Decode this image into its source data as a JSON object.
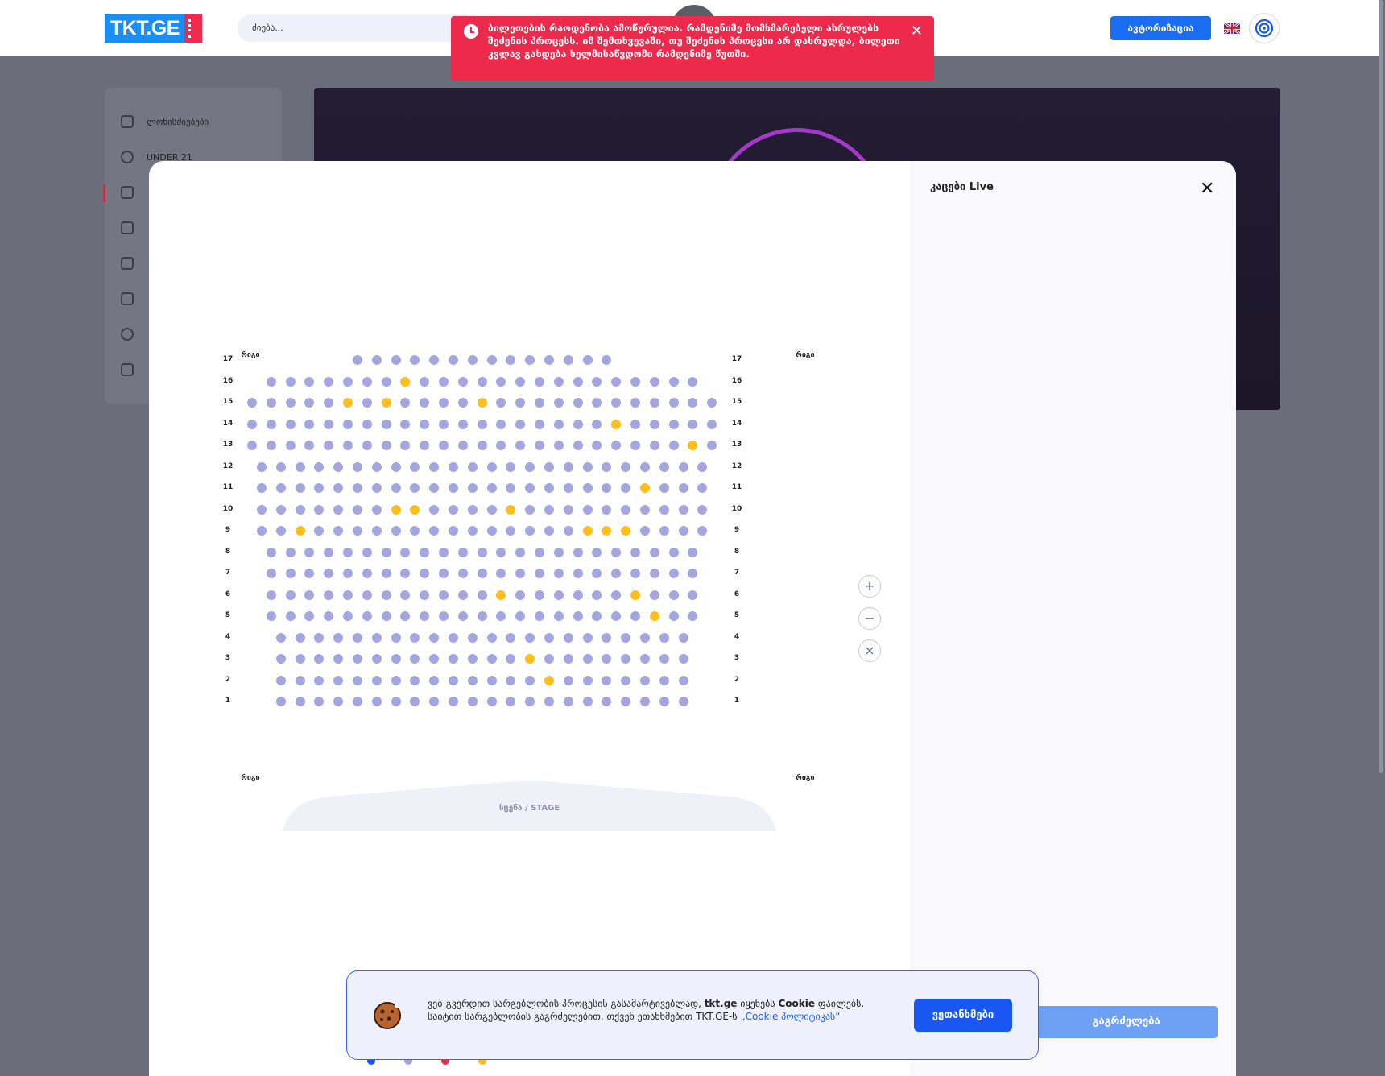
{
  "header": {
    "logo_text": "TKT.GE",
    "search_placeholder": "ძიება...",
    "auth_label": "ავტორიზაცია",
    "language_flag": "uk-flag-icon",
    "profile_icon": "settings-icon"
  },
  "sidebar": {
    "items": [
      {
        "label": "ლონისძიებები",
        "icon": "ticket-icon"
      },
      {
        "label": "UNDER 21",
        "icon": "globe-icon"
      },
      {
        "label": "",
        "icon": "music-icon"
      },
      {
        "label": "",
        "icon": "bus-icon"
      },
      {
        "label": "",
        "icon": "mask-icon"
      },
      {
        "label": "",
        "icon": "flag-icon"
      },
      {
        "label": "",
        "icon": "ball-icon"
      },
      {
        "label": "",
        "icon": "party-icon"
      }
    ]
  },
  "toast": {
    "message": "ბილეთების რაოდენობა ამოწურულია. რამდენიმე მომხმარებელი ასრულებს შეძენის პროცესს. იმ შემთხვევაში, თუ შეძენის პროცესი არ დასრულდა, ბილეთი კვლავ გახდება ხელმისაწვდომი რამდენიმე წუთში.",
    "close_label": "✕",
    "color": "#ee2a4c"
  },
  "modal": {
    "event_title": "კაცები Live",
    "close_label": "✕",
    "row_heading": "რიგი",
    "stage_label": "სცენა / STAGE",
    "continue_label": "გაგრძელება",
    "zoom": {
      "in": "+",
      "out": "−",
      "reset": "×"
    },
    "seat_colors": {
      "available": "#a5a6e0",
      "selected": "#fcbf1e"
    },
    "rows": [
      {
        "row": "17",
        "offset": 5.5,
        "count": 14,
        "selected": []
      },
      {
        "row": "16",
        "offset": 1,
        "count": 23,
        "selected": [
          8
        ]
      },
      {
        "row": "15",
        "offset": 0,
        "count": 25,
        "selected": [
          6,
          8,
          13
        ]
      },
      {
        "row": "14",
        "offset": 0,
        "count": 25,
        "selected": [
          20
        ]
      },
      {
        "row": "13",
        "offset": 0,
        "count": 25,
        "selected": [
          24
        ]
      },
      {
        "row": "12",
        "offset": 0.5,
        "count": 24,
        "selected": []
      },
      {
        "row": "11",
        "offset": 0.5,
        "count": 24,
        "selected": [
          21
        ]
      },
      {
        "row": "10",
        "offset": 0.5,
        "count": 24,
        "selected": [
          8,
          9,
          14
        ]
      },
      {
        "row": "9",
        "offset": 0.5,
        "count": 24,
        "selected": [
          3,
          18,
          19,
          20
        ]
      },
      {
        "row": "8",
        "offset": 1,
        "count": 23,
        "selected": []
      },
      {
        "row": "7",
        "offset": 1,
        "count": 23,
        "selected": []
      },
      {
        "row": "6",
        "offset": 1,
        "count": 23,
        "selected": [
          13,
          20
        ]
      },
      {
        "row": "5",
        "offset": 1,
        "count": 23,
        "selected": [
          21
        ]
      },
      {
        "row": "4",
        "offset": 1.5,
        "count": 22,
        "selected": []
      },
      {
        "row": "3",
        "offset": 1.5,
        "count": 22,
        "selected": [
          14
        ]
      },
      {
        "row": "2",
        "offset": 1.5,
        "count": 22,
        "selected": [
          15
        ]
      },
      {
        "row": "1",
        "offset": 1.5,
        "count": 22,
        "selected": []
      }
    ],
    "legend": [
      {
        "label": "",
        "color": "#1a56f0"
      },
      {
        "label": "",
        "color": "#a5a6e0"
      },
      {
        "label": "",
        "color": "#ee2a4c"
      },
      {
        "label": "",
        "color": "#fcbf1e"
      }
    ]
  },
  "cookie": {
    "text_part1": "ვებ-გვერდით სარგებლობის პროცესის გასამარტივებლად, ",
    "brand": "tkt.ge",
    "text_part2": " იყენებს ",
    "cookie_word": "Cookie",
    "text_part3": " ფაილებს. საიტით სარგებლობის გაგრძელებით, თქვენ ეთანხმებით TKT.GE-ს ",
    "policy_link": "„Cookie პოლიტიკას“",
    "agree_label": "ვეთანხმები"
  }
}
